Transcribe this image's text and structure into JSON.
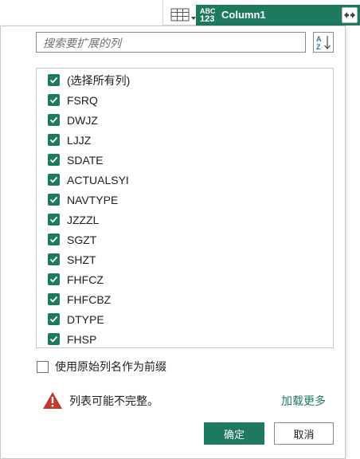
{
  "colors": {
    "accent": "#1e7a5f",
    "warning": "#c0392b"
  },
  "column_header": {
    "type_badge_line1": "ABC",
    "type_badge_line2": "123",
    "title": "Column1"
  },
  "popup": {
    "search_placeholder": "搜索要扩展的列",
    "sort_icon": "sort-az-icon",
    "items": [
      {
        "label": "(选择所有列)",
        "checked": true
      },
      {
        "label": "FSRQ",
        "checked": true
      },
      {
        "label": "DWJZ",
        "checked": true
      },
      {
        "label": "LJJZ",
        "checked": true
      },
      {
        "label": "SDATE",
        "checked": true
      },
      {
        "label": "ACTUALSYI",
        "checked": true
      },
      {
        "label": "NAVTYPE",
        "checked": true
      },
      {
        "label": "JZZZL",
        "checked": true
      },
      {
        "label": "SGZT",
        "checked": true
      },
      {
        "label": "SHZT",
        "checked": true
      },
      {
        "label": "FHFCZ",
        "checked": true
      },
      {
        "label": "FHFCBZ",
        "checked": true
      },
      {
        "label": "DTYPE",
        "checked": true
      },
      {
        "label": "FHSP",
        "checked": true
      }
    ],
    "prefix_label": "使用原始列名作为前缀",
    "prefix_checked": false,
    "warning_text": "列表可能不完整。",
    "load_more": "加载更多",
    "ok_label": "确定",
    "cancel_label": "取消"
  }
}
